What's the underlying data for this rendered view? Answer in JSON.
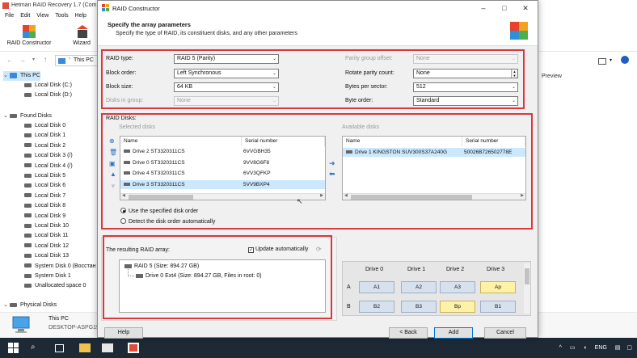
{
  "app": {
    "title": "Hetman RAID Recovery 1.7 (Com",
    "menu": [
      "File",
      "Edit",
      "View",
      "Tools",
      "Help"
    ],
    "toolbar": {
      "raid_constructor": "RAID Constructor",
      "wizard": "Wizard"
    },
    "address": "This PC",
    "preview_label": "Preview"
  },
  "tree": {
    "this_pc": "This PC",
    "local_disks": [
      "Local Disk (C:)",
      "Local Disk (D:)"
    ],
    "found_disks_label": "Found Disks",
    "found_disks": [
      "Local Disk 0",
      "Local Disk 1",
      "Local Disk 2",
      "Local Disk 3 (/)",
      "Local Disk 4 (/)",
      "Local Disk 5",
      "Local Disk 6",
      "Local Disk 7",
      "Local Disk 8",
      "Local Disk 9",
      "Local Disk 10",
      "Local Disk 11",
      "Local Disk 12",
      "Local Disk 13",
      "System Disk 0 (Восстан",
      "System Disk 1",
      "Unallocated space 0"
    ],
    "physical_disks_label": "Physical Disks"
  },
  "status": {
    "name": "This PC",
    "computer": "DESKTOP-ASPG19N"
  },
  "taskbar": {
    "lang": "ENG"
  },
  "dialog": {
    "title": "RAID Constructor",
    "heading": "Specify the array parameters",
    "subheading": "Specify the type of RAID, its constituent disks, and any other parameters",
    "params": {
      "raid_type_label": "RAID type:",
      "raid_type": "RAID 5 (Parity)",
      "block_order_label": "Block order:",
      "block_order": "Left Synchronous",
      "block_size_label": "Block size:",
      "block_size": "64 KB",
      "disks_in_group_label": "Disks in group:",
      "disks_in_group": "None",
      "parity_offset_label": "Parity group offset:",
      "parity_offset": "None",
      "rotate_parity_label": "Rotate parity count:",
      "rotate_parity": "None",
      "bytes_per_sector_label": "Bytes per sector:",
      "bytes_per_sector": "512",
      "byte_order_label": "Byte order:",
      "byte_order": "Standard"
    },
    "raid_disks": {
      "label": "RAID Disks:",
      "selected_label": "Selected disks",
      "available_label": "Available disks",
      "col_name": "Name",
      "col_serial": "Serial number",
      "selected": [
        {
          "name": "Drive 2 ST3320311CS",
          "serial": "6VVGBH35"
        },
        {
          "name": "Drive 0 ST3320311CS",
          "serial": "9VV8G6F8"
        },
        {
          "name": "Drive 4 ST3320311CS",
          "serial": "6VV3QFKP"
        },
        {
          "name": "Drive 3 ST3320311CS",
          "serial": "5VV9BXP4"
        }
      ],
      "available": [
        {
          "name": "Drive 1 KINGSTON SUV300S37A240G",
          "serial": "50026B726502778E"
        }
      ],
      "use_specified": "Use the specified disk order",
      "detect_auto": "Detect the disk order automatically"
    },
    "result": {
      "label": "The resulting RAID array:",
      "update_auto": "Update automatically",
      "root": "RAID 5 (Size: 894.27 GB)",
      "child": "Drive 0 Ext4 (Size: 894.27 GB, Files in root: 0)"
    },
    "map": {
      "columns": [
        "Drive 0",
        "Drive 1",
        "Drive 2",
        "Drive 3"
      ],
      "rows": [
        {
          "label": "A",
          "cells": [
            "A1",
            "A2",
            "A3",
            "Ap"
          ]
        },
        {
          "label": "B",
          "cells": [
            "B2",
            "B3",
            "Bp",
            "B1"
          ]
        }
      ]
    },
    "buttons": {
      "help": "Help",
      "back": "< Back",
      "add": "Add",
      "cancel": "Cancel"
    }
  }
}
